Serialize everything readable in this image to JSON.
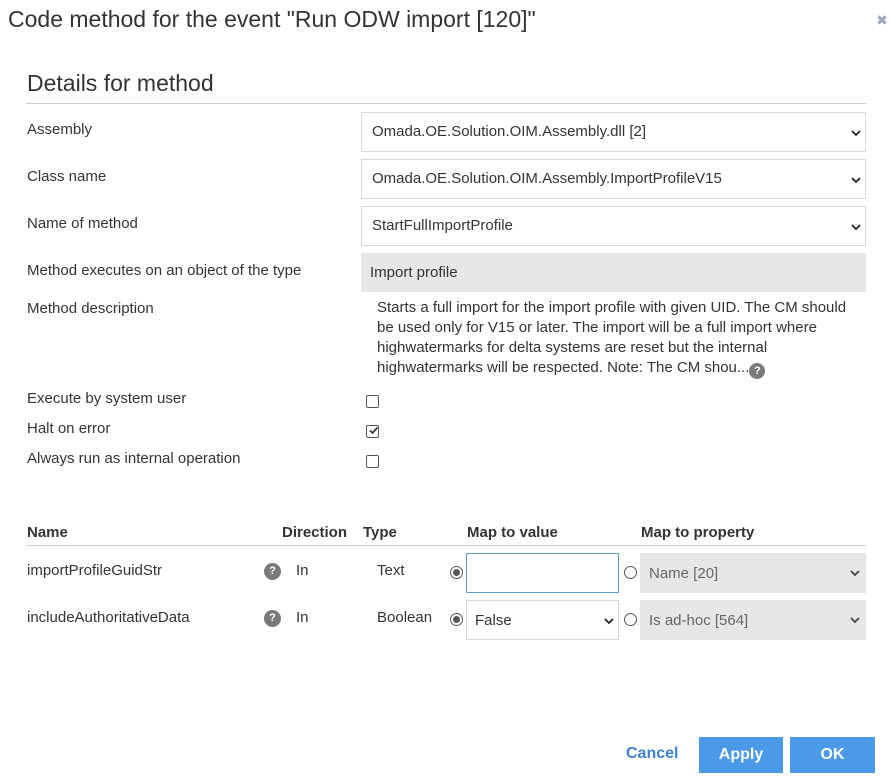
{
  "dialog": {
    "title": "Code method for the event \"Run ODW import [120]\"",
    "close_icon": "close-icon",
    "close_glyph": "✖"
  },
  "details": {
    "section_title": "Details for method",
    "assembly_label": "Assembly",
    "assembly_value": "Omada.OE.Solution.OIM.Assembly.dll [2]",
    "class_label": "Class name",
    "class_value": "Omada.OE.Solution.OIM.Assembly.ImportProfileV15",
    "method_label": "Name of method",
    "method_value": "StartFullImportProfile",
    "object_type_label": "Method executes on an object of the type",
    "object_type_value": "Import profile",
    "description_label": "Method description",
    "description_value": "Starts a full import for the import profile with given UID. The CM should be used only for V15 or later. The import will be a full import where highwatermarks for delta systems are reset but the internal highwatermarks will be respected. Note: The CM shou...",
    "description_help": "?",
    "system_user_label": "Execute by system user",
    "system_user_checked": false,
    "halt_label": "Halt on error",
    "halt_checked": true,
    "internal_label": "Always run as internal operation",
    "internal_checked": false
  },
  "params": {
    "columns": [
      "Name",
      "Direction",
      "Type",
      "Map to value",
      "Map to property"
    ],
    "rows": [
      {
        "name": "importProfileGuidStr",
        "help": "?",
        "direction": "In",
        "type": "Text",
        "map_value": "",
        "map_property": "Name [20]",
        "value_selected": true
      },
      {
        "name": "includeAuthoritativeData",
        "help": "?",
        "direction": "In",
        "type": "Boolean",
        "map_value": "False",
        "map_property": "Is ad-hoc [564]",
        "value_selected": true
      }
    ]
  },
  "footer": {
    "cancel": "Cancel",
    "apply": "Apply",
    "ok": "OK"
  },
  "colors": {
    "accent": "#4a9ae8",
    "link": "#3b7fd1",
    "readonly_bg": "#e6e6e6"
  }
}
